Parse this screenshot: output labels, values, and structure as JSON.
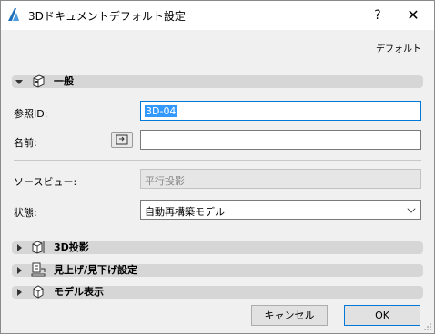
{
  "window": {
    "title": "3Dドキュメントデフォルト設定",
    "help_label": "?",
    "close_label": "✕"
  },
  "header": {
    "default_link": "デフォルト"
  },
  "sections": {
    "general": {
      "label": "一般",
      "icon": "general-settings-icon"
    },
    "projection": {
      "label": "3D投影",
      "icon": "3d-projection-icon"
    },
    "view": {
      "label": "見上げ/見下げ設定",
      "icon": "view-direction-icon"
    },
    "model": {
      "label": "モデル表示",
      "icon": "model-display-icon"
    }
  },
  "form": {
    "ref_id_label": "参照ID:",
    "ref_id_value": "3D-04",
    "name_label": "名前:",
    "name_value": "",
    "source_view_label": "ソースビュー:",
    "source_view_value": "平行投影",
    "state_label": "状態:",
    "state_value": "自動再構築モデル"
  },
  "buttons": {
    "cancel": "キャンセル",
    "ok": "OK"
  },
  "colors": {
    "focus": "#0078d7",
    "selection": "#3399ff",
    "section_bar": "#d6d6d6"
  }
}
